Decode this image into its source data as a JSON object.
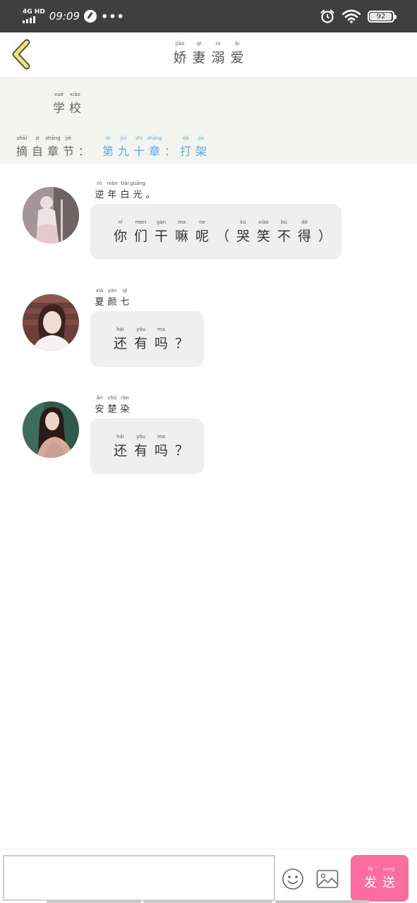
{
  "status_bar": {
    "network": "4G HD",
    "time": "09:09",
    "more": "•••",
    "battery": "92"
  },
  "header": {
    "title": [
      {
        "py": "jiāo",
        "hz": "娇"
      },
      {
        "py": "qī",
        "hz": "妻"
      },
      {
        "py": "nì",
        "hz": "溺"
      },
      {
        "py": "ài",
        "hz": "爱"
      }
    ]
  },
  "info": {
    "school": [
      {
        "py": "xué",
        "hz": "学"
      },
      {
        "py": "xiào",
        "hz": "校"
      }
    ],
    "chapter_label": [
      {
        "py": "zhāi",
        "hz": "摘"
      },
      {
        "py": "zì",
        "hz": "自"
      },
      {
        "py": "zhāng",
        "hz": "章"
      },
      {
        "py": "jié",
        "hz": "节"
      },
      {
        "py": "",
        "hz": "："
      }
    ],
    "chapter_link": [
      {
        "py": "dì",
        "hz": "第"
      },
      {
        "py": "jiǔ",
        "hz": "九"
      },
      {
        "py": "shí",
        "hz": "十"
      },
      {
        "py": "zhāng",
        "hz": "章"
      },
      {
        "py": "",
        "hz": "："
      },
      {
        "py": "dǎ",
        "hz": "打"
      },
      {
        "py": "jià",
        "hz": "架"
      }
    ]
  },
  "messages": [
    {
      "sender": [
        {
          "py": "nì",
          "hz": "逆"
        },
        {
          "py": "nián",
          "hz": "年"
        },
        {
          "py": "bái",
          "hz": "白"
        },
        {
          "py": "guāng",
          "hz": "光"
        },
        {
          "py": "",
          "hz": "。"
        }
      ],
      "text": [
        {
          "py": "nǐ",
          "hz": "你"
        },
        {
          "py": "men",
          "hz": "们"
        },
        {
          "py": "gàn",
          "hz": "干"
        },
        {
          "py": "ma",
          "hz": "嘛"
        },
        {
          "py": "ne",
          "hz": "呢"
        },
        {
          "py": "",
          "hz": "（"
        },
        {
          "py": "kū",
          "hz": "哭"
        },
        {
          "py": "xiào",
          "hz": "笑"
        },
        {
          "py": "bù",
          "hz": "不"
        },
        {
          "py": "dé",
          "hz": "得"
        },
        {
          "py": "",
          "hz": "）"
        }
      ]
    },
    {
      "sender": [
        {
          "py": "xià",
          "hz": "夏"
        },
        {
          "py": "yán",
          "hz": "颜"
        },
        {
          "py": "qī",
          "hz": "七"
        }
      ],
      "text": [
        {
          "py": "hái",
          "hz": "还"
        },
        {
          "py": "yǒu",
          "hz": "有"
        },
        {
          "py": "ma",
          "hz": "吗"
        },
        {
          "py": "",
          "hz": "？"
        }
      ]
    },
    {
      "sender": [
        {
          "py": "ān",
          "hz": "安"
        },
        {
          "py": "chǔ",
          "hz": "楚"
        },
        {
          "py": "rǎn",
          "hz": "染"
        }
      ],
      "text": [
        {
          "py": "hái",
          "hz": "还"
        },
        {
          "py": "yǒu",
          "hz": "有"
        },
        {
          "py": "ma",
          "hz": "吗"
        },
        {
          "py": "",
          "hz": "？"
        }
      ]
    }
  ],
  "input_bar": {
    "input_value": "",
    "emoji_icon": "smiley-icon",
    "image_icon": "image-icon",
    "send": [
      {
        "py": "fā",
        "hz": "发"
      },
      {
        "py": "sòng",
        "hz": "送"
      }
    ]
  },
  "colors": {
    "status_bar": "#3f3f3f",
    "info_bg": "#f3f3ef",
    "link": "#5aa9e6",
    "bubble": "#efefef",
    "send_button": "#fd6d9f",
    "back_arrow": "#f5e46a"
  }
}
